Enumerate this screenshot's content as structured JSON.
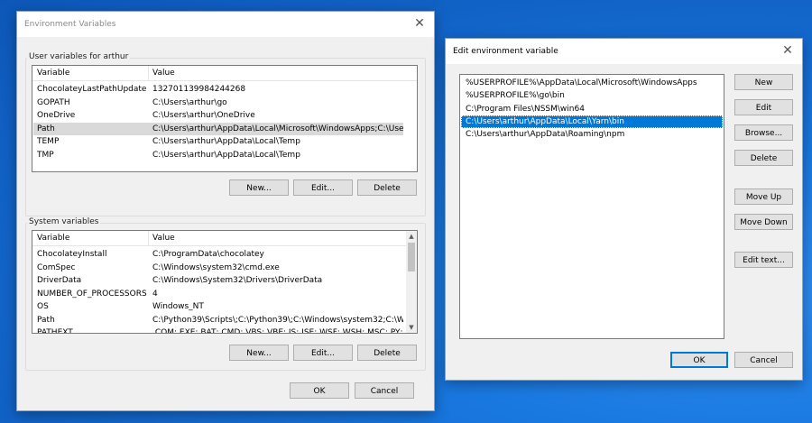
{
  "env_dialog": {
    "title": "Environment Variables",
    "close_glyph": "✕",
    "user_group_label": "User variables for arthur",
    "user_columns": [
      "Variable",
      "Value"
    ],
    "user_rows": [
      {
        "variable": "ChocolateyLastPathUpdate",
        "value": "132701139984244268"
      },
      {
        "variable": "GOPATH",
        "value": "C:\\Users\\arthur\\go"
      },
      {
        "variable": "OneDrive",
        "value": "C:\\Users\\arthur\\OneDrive"
      },
      {
        "variable": "Path",
        "value": "C:\\Users\\arthur\\AppData\\Local\\Microsoft\\WindowsApps;C:\\Users\\..."
      },
      {
        "variable": "TEMP",
        "value": "C:\\Users\\arthur\\AppData\\Local\\Temp"
      },
      {
        "variable": "TMP",
        "value": "C:\\Users\\arthur\\AppData\\Local\\Temp"
      }
    ],
    "user_buttons": {
      "new": "New...",
      "edit": "Edit...",
      "delete": "Delete"
    },
    "system_group_label": "System variables",
    "system_columns": [
      "Variable",
      "Value"
    ],
    "system_rows": [
      {
        "variable": "ChocolateyInstall",
        "value": "C:\\ProgramData\\chocolatey"
      },
      {
        "variable": "ComSpec",
        "value": "C:\\Windows\\system32\\cmd.exe"
      },
      {
        "variable": "DriverData",
        "value": "C:\\Windows\\System32\\Drivers\\DriverData"
      },
      {
        "variable": "NUMBER_OF_PROCESSORS",
        "value": "4"
      },
      {
        "variable": "OS",
        "value": "Windows_NT"
      },
      {
        "variable": "Path",
        "value": "C:\\Python39\\Scripts\\;C:\\Python39\\;C:\\Windows\\system32;C:\\Wind..."
      },
      {
        "variable": "PATHEXT",
        "value": ".COM;.EXE;.BAT;.CMD;.VBS;.VBE;.JS;.JSE;.WSF;.WSH;.MSC;.PY;.PYW"
      }
    ],
    "system_buttons": {
      "new": "New...",
      "edit": "Edit...",
      "delete": "Delete"
    },
    "ok": "OK",
    "cancel": "Cancel"
  },
  "edit_dialog": {
    "title": "Edit environment variable",
    "close_glyph": "✕",
    "items": [
      "%USERPROFILE%\\AppData\\Local\\Microsoft\\WindowsApps",
      "%USERPROFILE%\\go\\bin",
      "C:\\Program Files\\NSSM\\win64",
      "C:\\Users\\arthur\\AppData\\Local\\Yarn\\bin",
      "C:\\Users\\arthur\\AppData\\Roaming\\npm"
    ],
    "selected_index": 3,
    "buttons": {
      "new": "New",
      "edit": "Edit",
      "browse": "Browse...",
      "delete": "Delete",
      "move_up": "Move Up",
      "move_down": "Move Down",
      "edit_text": "Edit text..."
    },
    "ok": "OK",
    "cancel": "Cancel"
  },
  "colors": {
    "selection_blue": "#0078d7",
    "dialog_bg": "#f0f0f0",
    "desktop_blue": "#1978e0"
  }
}
